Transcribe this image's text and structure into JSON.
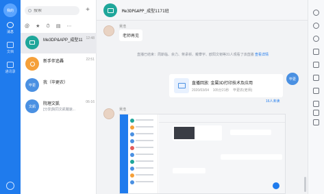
{
  "nav": {
    "me_avatar_text": "我的",
    "items": [
      {
        "label": "消息",
        "icon": "chat-bubble-icon",
        "active": true
      },
      {
        "label": "文档",
        "icon": "document-icon",
        "active": false
      },
      {
        "label": "通讯录",
        "icon": "contacts-icon",
        "active": false
      }
    ],
    "settings_icon": "settings-icon"
  },
  "sidebar": {
    "search_placeholder": "搜索",
    "add_label": "+",
    "filters": [
      "@",
      "★",
      "⏱",
      "▤",
      "⋯"
    ],
    "conversations": [
      {
        "name": "Me3DP&APP_成型1171班",
        "time": "12:48",
        "preview": "",
        "avatar_text": "",
        "avatar_color": "#1ea69a",
        "selected": true
      },
      {
        "name": "新手伴追轟",
        "time": "22:51",
        "preview": "",
        "avatar_text": "",
        "avatar_color": "#f5a03a",
        "selected": false
      },
      {
        "name": "我（毕更农）",
        "time": "",
        "preview": "",
        "avatar_text": "毕更",
        "avatar_color": "#4a90e2",
        "selected": false
      },
      {
        "name": "院理文凱",
        "time": "06-16",
        "preview": "[分享]院同文凱隴速...",
        "avatar_text": "文凱",
        "avatar_color": "#4a90e2",
        "selected": false
      }
    ]
  },
  "chat": {
    "title": "Me3DP&APP_成型1171班",
    "messages": {
      "first": {
        "sender": "吴浩",
        "text": "老师再见"
      },
      "system": {
        "text": "直播已结束：周斯临、余力、蒋承祯、戴攀宇、欧阳文韧等31人观看了该直播",
        "link": "查看详情"
      },
      "card": {
        "title": "直播回放: 金属3D打印技术及应用",
        "date": "2020/03/04",
        "duration": "105分21秒",
        "host": "毕更农(老师)",
        "avatar_text": "毕更",
        "unread": "16人未读"
      },
      "second": {
        "sender": "吴浩"
      }
    }
  },
  "toolbar_icons": [
    "settings-icon",
    "add-member-icon",
    "clock-icon",
    "ding-icon",
    "megaphone-icon",
    "play-icon",
    "schedule-icon",
    "book-icon",
    "calendar-icon",
    "cube-icon"
  ],
  "colors": {
    "brand_blue": "#1f7bed",
    "group_teal": "#1ea69a",
    "orange": "#f5a03a"
  }
}
